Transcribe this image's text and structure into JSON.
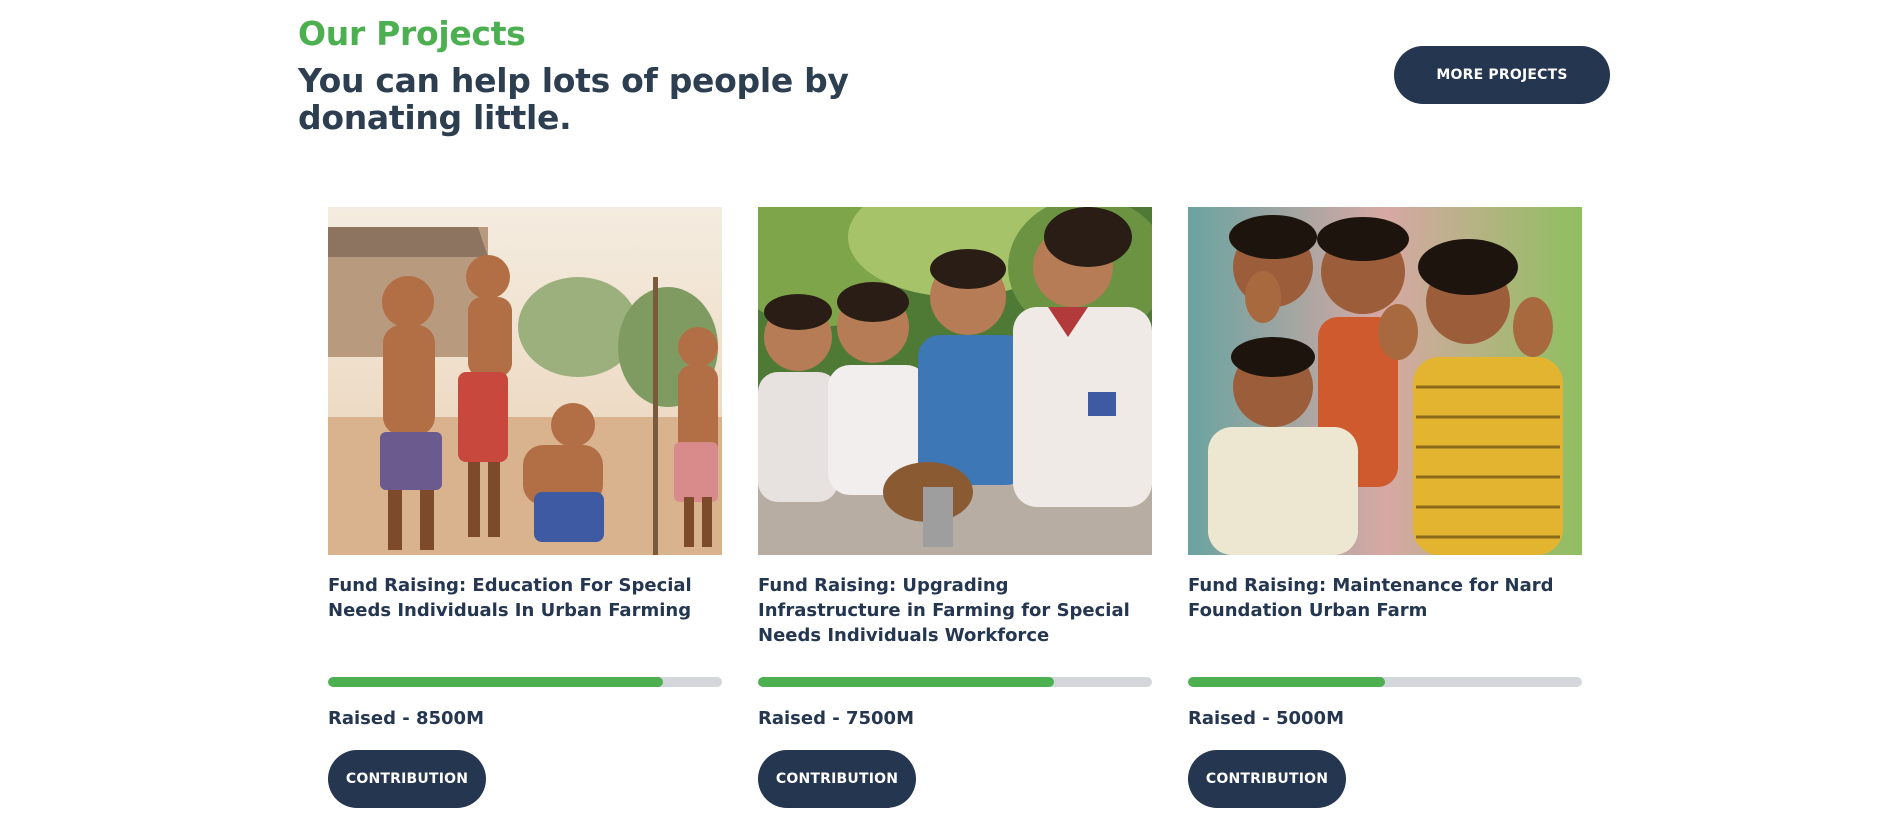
{
  "section": {
    "kicker": "Our Projects",
    "heading": "You can help lots of people by donating little.",
    "more_button": "MORE PROJECTS"
  },
  "colors": {
    "accent_green": "#4caf50",
    "navy": "#243650",
    "track_gray": "#d3d7dc"
  },
  "projects": [
    {
      "image_icon": "children-photo-icon",
      "title": "Fund Raising: Education For Special Needs Individuals In Urban Farming",
      "progress": 0.85,
      "raised": "Raised - 8500M",
      "button": "CONTRIBUTION"
    },
    {
      "image_icon": "children-photo-icon",
      "title": "Fund Raising: Upgrading Infrastructure in Farming for Special Needs Individuals Workforce",
      "progress": 0.75,
      "raised": "Raised - 7500M",
      "button": "CONTRIBUTION"
    },
    {
      "image_icon": "children-photo-icon",
      "title": "Fund Raising: Maintenance for Nard Foundation Urban Farm",
      "progress": 0.5,
      "raised": "Raised - 5000M",
      "button": "CONTRIBUTION"
    }
  ]
}
